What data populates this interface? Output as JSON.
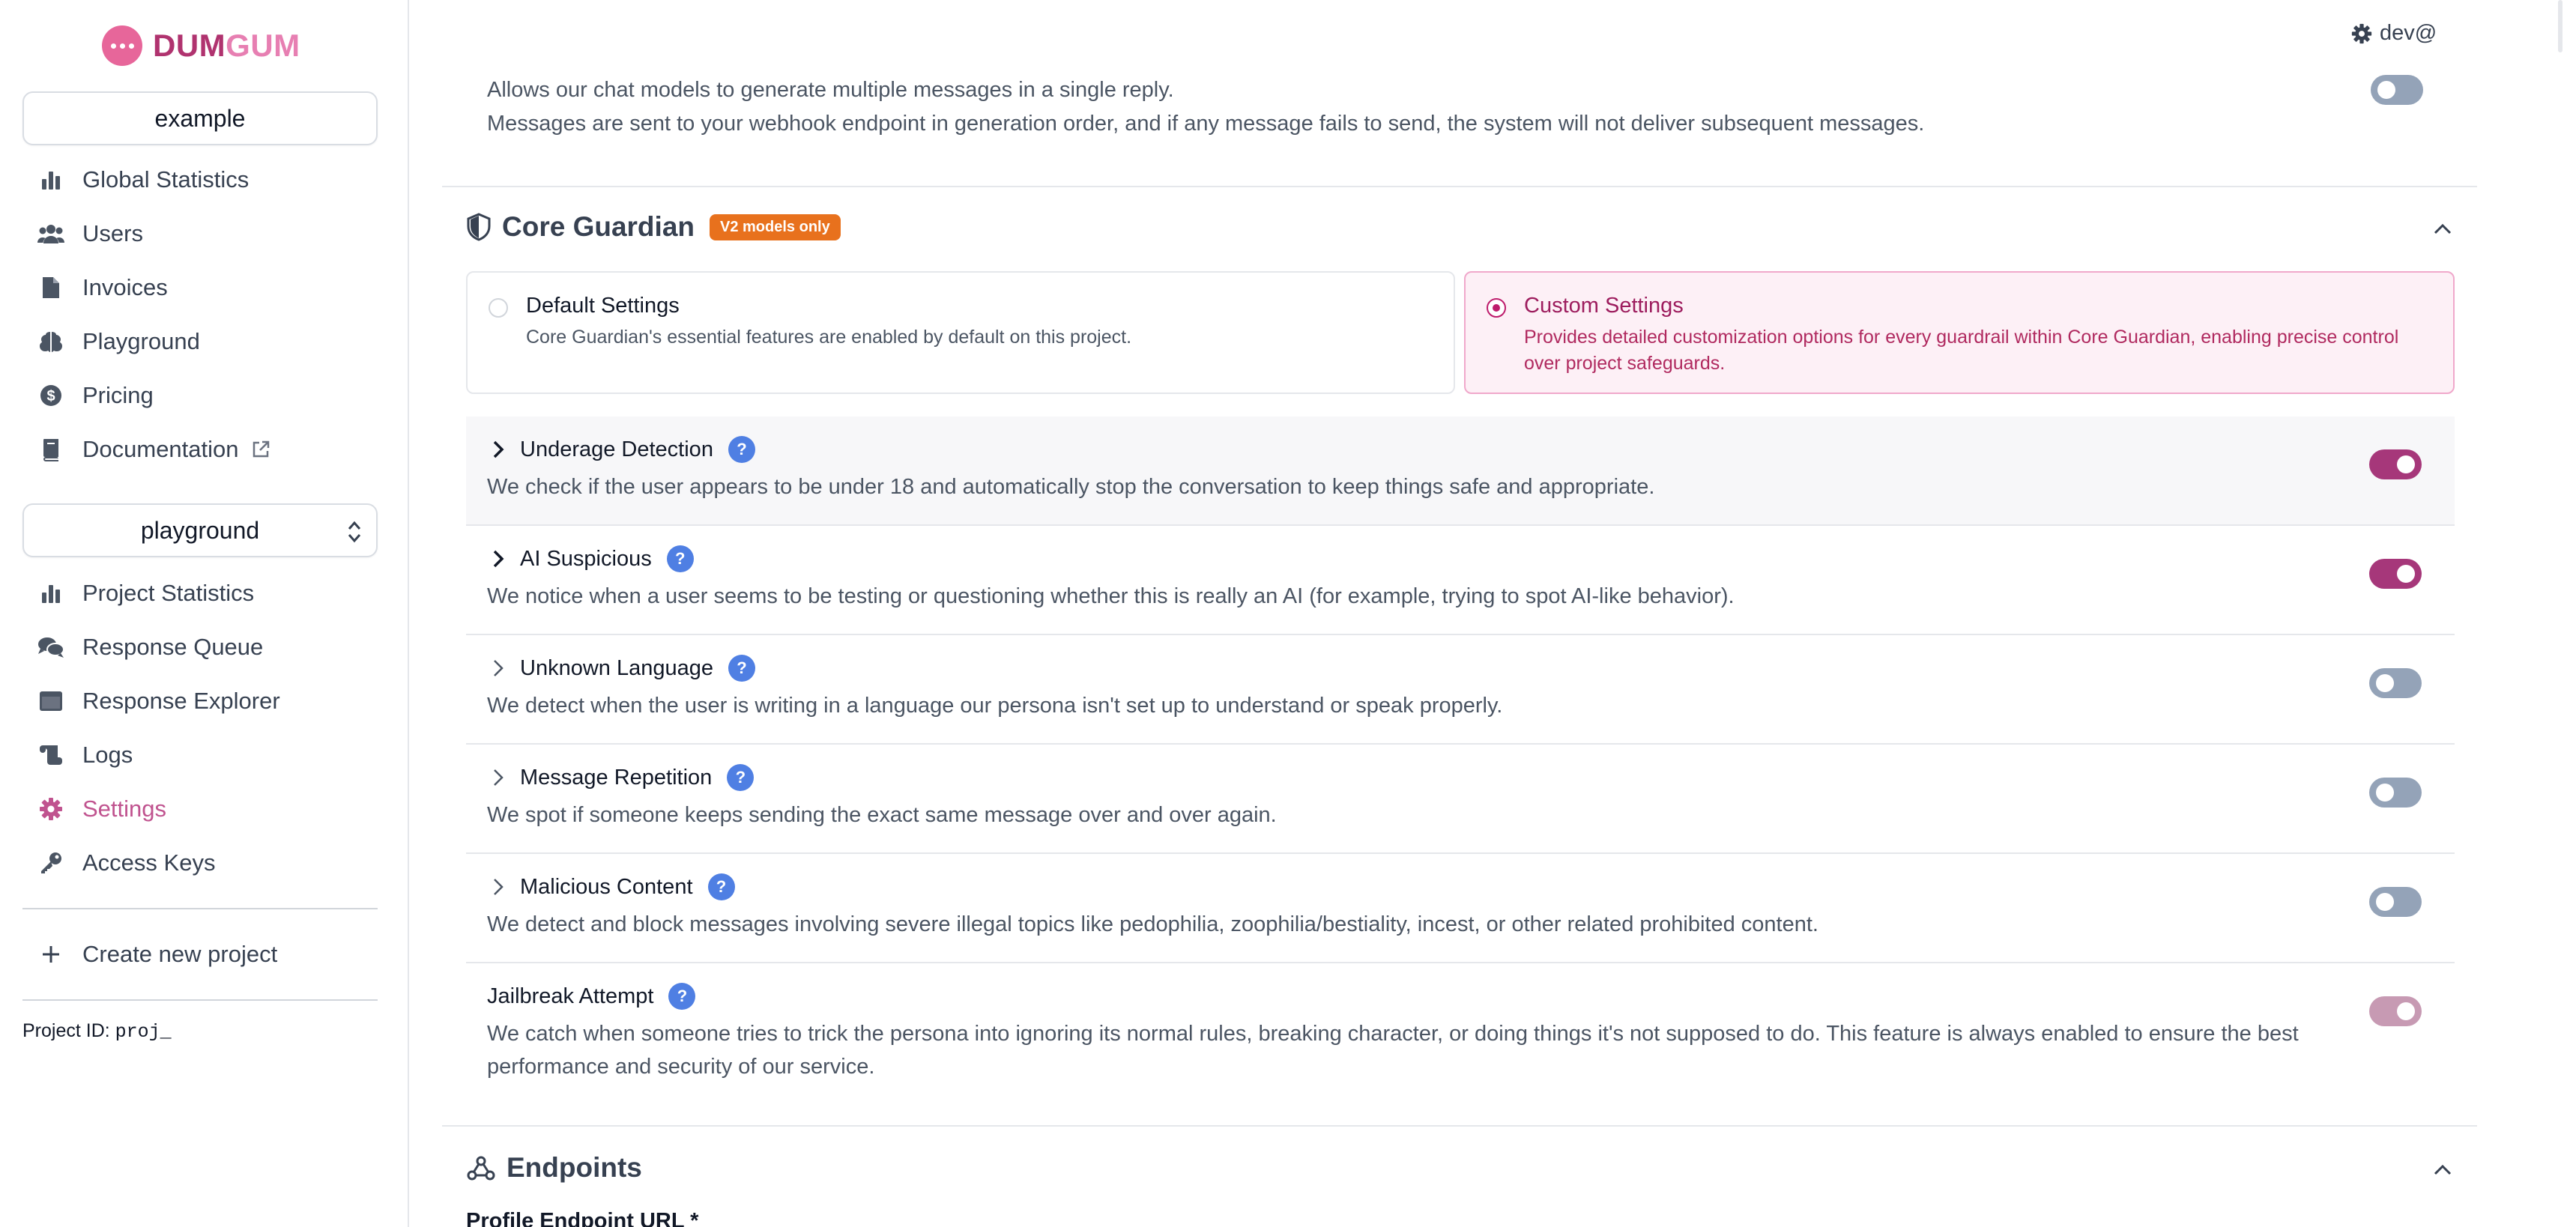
{
  "brand": {
    "part1": "DUM",
    "part2": "GUM"
  },
  "sidebar": {
    "org_selector": "example",
    "global_nav": [
      {
        "label": "Global Statistics",
        "icon": "bar-chart-icon"
      },
      {
        "label": "Users",
        "icon": "users-icon"
      },
      {
        "label": "Invoices",
        "icon": "document-icon"
      },
      {
        "label": "Playground",
        "icon": "brain-icon"
      },
      {
        "label": "Pricing",
        "icon": "dollar-coin-icon"
      },
      {
        "label": "Documentation",
        "icon": "book-icon"
      }
    ],
    "project_selector": "playground",
    "project_nav": [
      {
        "label": "Project Statistics",
        "icon": "bar-chart-icon"
      },
      {
        "label": "Response Queue",
        "icon": "chat-bubbles-icon"
      },
      {
        "label": "Response Explorer",
        "icon": "window-icon"
      },
      {
        "label": "Logs",
        "icon": "scroll-icon"
      },
      {
        "label": "Settings",
        "icon": "gear-icon",
        "active": true
      },
      {
        "label": "Access Keys",
        "icon": "key-icon"
      }
    ],
    "create_project": "Create new project",
    "project_id_label": "Project ID:",
    "project_id_value": "proj_"
  },
  "header": {
    "user": "dev@"
  },
  "multi_message": {
    "line1": "Allows our chat models to generate multiple messages in a single reply.",
    "line2": "Messages are sent to your webhook endpoint in generation order, and if any message fails to send, the system will not deliver subsequent messages.",
    "enabled": false
  },
  "core_guardian": {
    "title": "Core Guardian",
    "badge": "V2 models only",
    "default_option": {
      "title": "Default Settings",
      "description": "Core Guardian's essential features are enabled by default on this project."
    },
    "custom_option": {
      "title": "Custom Settings",
      "description": "Provides detailed customization options for every guardrail within Core Guardian, enabling precise control over project safeguards."
    },
    "selected": "custom",
    "guardrails": [
      {
        "name": "Underage Detection",
        "description": "We check if the user appears to be under 18 and automatically stop the conversation to keep things safe and appropriate.",
        "enabled": true
      },
      {
        "name": "AI Suspicious",
        "description": "We notice when a user seems to be testing or questioning whether this is really an AI (for example, trying to spot AI-like behavior).",
        "enabled": true
      },
      {
        "name": "Unknown Language",
        "description": "We detect when the user is writing in a language our persona isn't set up to understand or speak properly.",
        "enabled": false
      },
      {
        "name": "Message Repetition",
        "description": "We spot if someone keeps sending the exact same message over and over again.",
        "enabled": false
      },
      {
        "name": "Malicious Content",
        "description": "We detect and block messages involving severe illegal topics like pedophilia, zoophilia/bestiality, incest, or other related prohibited content.",
        "enabled": false
      },
      {
        "name": "Jailbreak Attempt",
        "description": "We catch when someone tries to trick the persona into ignoring its normal rules, breaking character, or doing things it's not supposed to do. This feature is always enabled to ensure the best performance and security of our service.",
        "enabled": true,
        "locked": true
      }
    ],
    "help_glyph": "?"
  },
  "endpoints": {
    "title": "Endpoints",
    "profile_url_label": "Profile Endpoint URL *"
  },
  "colors": {
    "accent": "#a6377a",
    "active_nav": "#c0538f",
    "badge": "#e8711d",
    "help": "#4f7fe3"
  }
}
